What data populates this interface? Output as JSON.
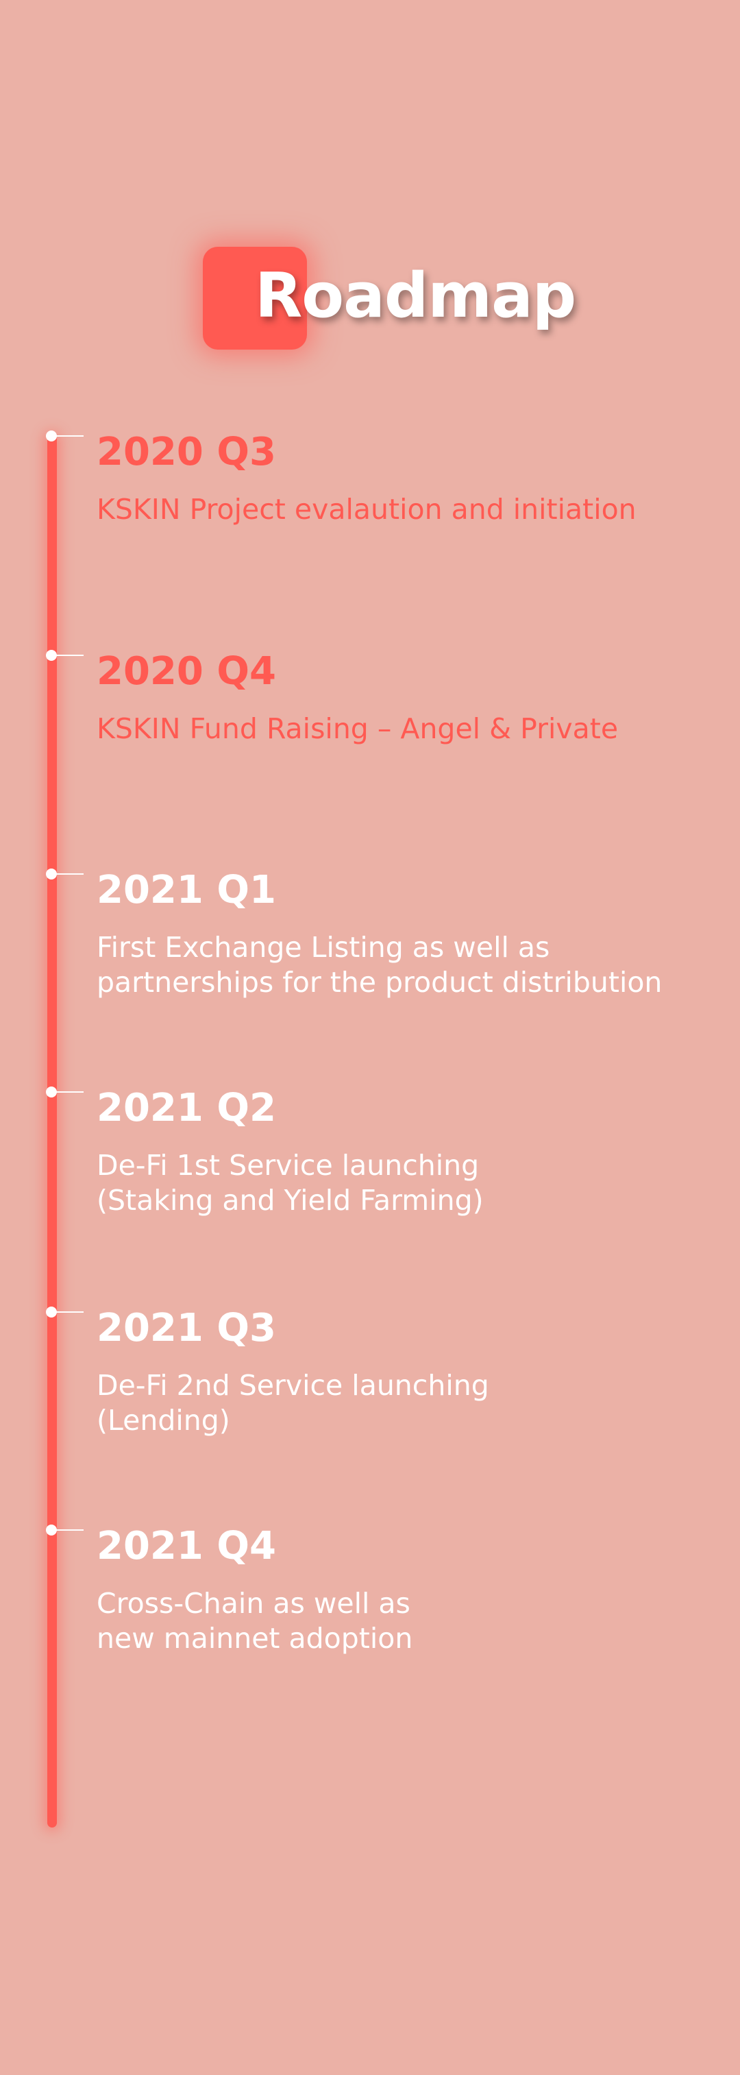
{
  "page": {
    "title": "Roadmap",
    "colors": {
      "background": "#ebb1a6",
      "accent": "#ff5a52",
      "text_light": "#ffffff"
    }
  },
  "milestones": [
    {
      "period": "2020 Q3",
      "description": "KSKIN Project evalaution and initiation"
    },
    {
      "period": "2020 Q4",
      "description": "KSKIN Fund Raising – Angel & Private"
    },
    {
      "period": "2021 Q1",
      "description": "First Exchange Listing as well as\npartnerships for the product distribution"
    },
    {
      "period": "2021 Q2",
      "description": "De-Fi 1st Service launching\n(Staking and Yield Farming)"
    },
    {
      "period": "2021 Q3",
      "description": "De-Fi 2nd Service launching\n(Lending)"
    },
    {
      "period": "2021 Q4",
      "description": "Cross-Chain as well as\nnew mainnet adoption"
    }
  ]
}
